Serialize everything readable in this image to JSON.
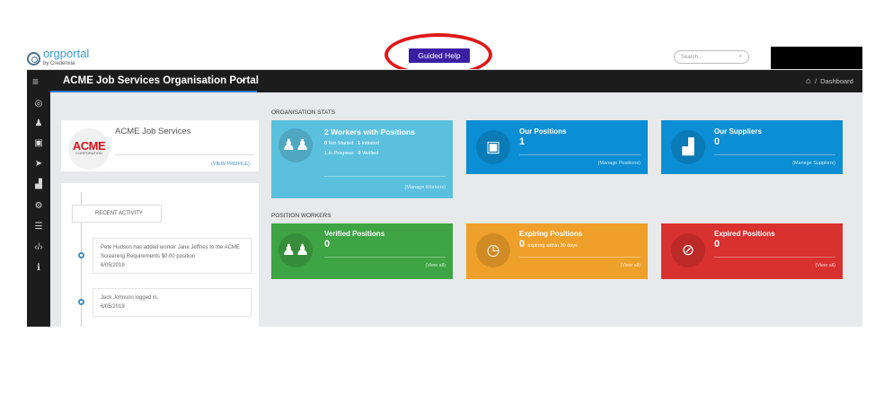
{
  "logo": {
    "name": "orgportal",
    "sub": "by Credenxia"
  },
  "guided_help": "Guided Help",
  "search": {
    "placeholder": "Search..."
  },
  "navbar": {
    "title": "ACME Job Services Organisation Portal",
    "breadcrumb": "Dashboard"
  },
  "sidebar": {
    "icons": [
      "dashboard-icon",
      "users-icon",
      "briefcase-icon",
      "send-icon",
      "factory-icon",
      "users-cog-icon",
      "list-icon",
      "code-icon",
      "info-icon"
    ]
  },
  "org": {
    "logo_word": "ACME",
    "logo_sub": "CORPORATION",
    "name": "ACME Job Services",
    "view_profile": "(VIEW PROFILE)"
  },
  "activity": {
    "heading": "RECENT ACTIVITY",
    "items": [
      {
        "text": "Pete Hudson has added worker Jane Jeffries to the ACME Screening Requirements $0.00 position",
        "date": "6/05/2019"
      },
      {
        "text": "Jack Johnson logged in.",
        "date": "6/05/2019"
      }
    ]
  },
  "org_stats": {
    "label": "ORGANISATION STATS",
    "workers": {
      "count": "2",
      "title": "Workers with Positions",
      "not_started": "0",
      "not_started_label": "Not Started",
      "initiated": "1",
      "initiated_label": "Initiated",
      "in_progress": "1",
      "in_progress_label": "In Progress",
      "verified": "0",
      "verified_label": "Verified",
      "link": "(Manage Workers)",
      "color": "#5bc0de"
    },
    "positions": {
      "title": "Our Positions",
      "count": "1",
      "link": "(Manage Positions)",
      "color": "#0b8ed3"
    },
    "suppliers": {
      "title": "Our Suppliers",
      "count": "0",
      "link": "(Manage Suppliers)",
      "color": "#0b8ed3"
    }
  },
  "position_workers": {
    "label": "POSITION WORKERS",
    "verified": {
      "title": "Verified Positions",
      "count": "0",
      "link": "(View all)",
      "color": "#3fa444"
    },
    "expiring": {
      "title": "Expiring Positions",
      "count": "0",
      "sub": "expiring within 30 days",
      "link": "(View all)",
      "color": "#efa02a"
    },
    "expired": {
      "title": "Expired Positions",
      "count": "0",
      "link": "(View all)",
      "color": "#d8312f"
    }
  }
}
